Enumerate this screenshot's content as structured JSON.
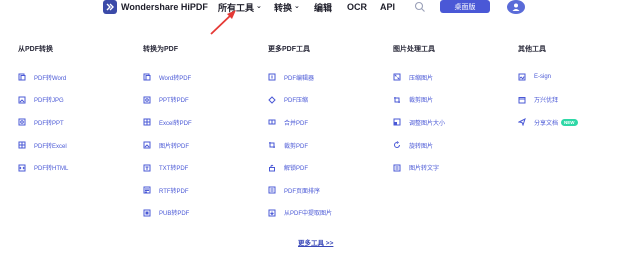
{
  "nav": {
    "brand": "Wondershare HiPDF",
    "all_tools": "所有工具",
    "convert": "转换",
    "edit": "编辑",
    "ocr": "OCR",
    "api": "API",
    "cta": "桌面版"
  },
  "colors": {
    "accent": "#4a58d6",
    "badge": "#2ed8a6",
    "annotation": "#e53935"
  },
  "columns": [
    {
      "title": "从PDF转换",
      "items": [
        {
          "label": "PDF转Word",
          "icon": "doc-convert-icon"
        },
        {
          "label": "PDF转JPG",
          "icon": "image-convert-icon"
        },
        {
          "label": "PDF转PPT",
          "icon": "ppt-convert-icon"
        },
        {
          "label": "PDF转Excel",
          "icon": "excel-convert-icon"
        },
        {
          "label": "PDF转HTML",
          "icon": "html-convert-icon"
        }
      ]
    },
    {
      "title": "转换为PDF",
      "items": [
        {
          "label": "Word转PDF",
          "icon": "doc-convert-icon"
        },
        {
          "label": "PPT转PDF",
          "icon": "ppt-convert-icon"
        },
        {
          "label": "Excel转PDF",
          "icon": "excel-convert-icon"
        },
        {
          "label": "图片转PDF",
          "icon": "image-convert-icon"
        },
        {
          "label": "TXT转PDF",
          "icon": "txt-convert-icon"
        },
        {
          "label": "RTF转PDF",
          "icon": "rtf-convert-icon"
        },
        {
          "label": "PUB转PDF",
          "icon": "pub-convert-icon"
        }
      ]
    },
    {
      "title": "更多PDF工具",
      "items": [
        {
          "label": "PDF编辑器",
          "icon": "edit-icon"
        },
        {
          "label": "PDF压缩",
          "icon": "compress-icon"
        },
        {
          "label": "合并PDF",
          "icon": "merge-icon"
        },
        {
          "label": "裁剪PDF",
          "icon": "crop-icon"
        },
        {
          "label": "解锁PDF",
          "icon": "unlock-icon"
        },
        {
          "label": "PDF页面排序",
          "icon": "reorder-icon"
        },
        {
          "label": "从PDF中提取图片",
          "icon": "extract-icon"
        }
      ]
    },
    {
      "title": "图片处理工具",
      "items": [
        {
          "label": "压缩图片",
          "icon": "compress-image-icon"
        },
        {
          "label": "裁剪图片",
          "icon": "crop-image-icon"
        },
        {
          "label": "调整图片大小",
          "icon": "resize-image-icon"
        },
        {
          "label": "旋转图片",
          "icon": "rotate-image-icon"
        },
        {
          "label": "图片转文字",
          "icon": "image-to-text-icon"
        }
      ]
    },
    {
      "title": "其他工具",
      "items": [
        {
          "label": "E-sign",
          "icon": "esign-icon"
        },
        {
          "label": "万兴优拜",
          "icon": "calendar-icon"
        },
        {
          "label": "分享文档",
          "icon": "share-icon",
          "badge": "NEW"
        }
      ]
    }
  ],
  "more_tools": "更多工具 >>"
}
